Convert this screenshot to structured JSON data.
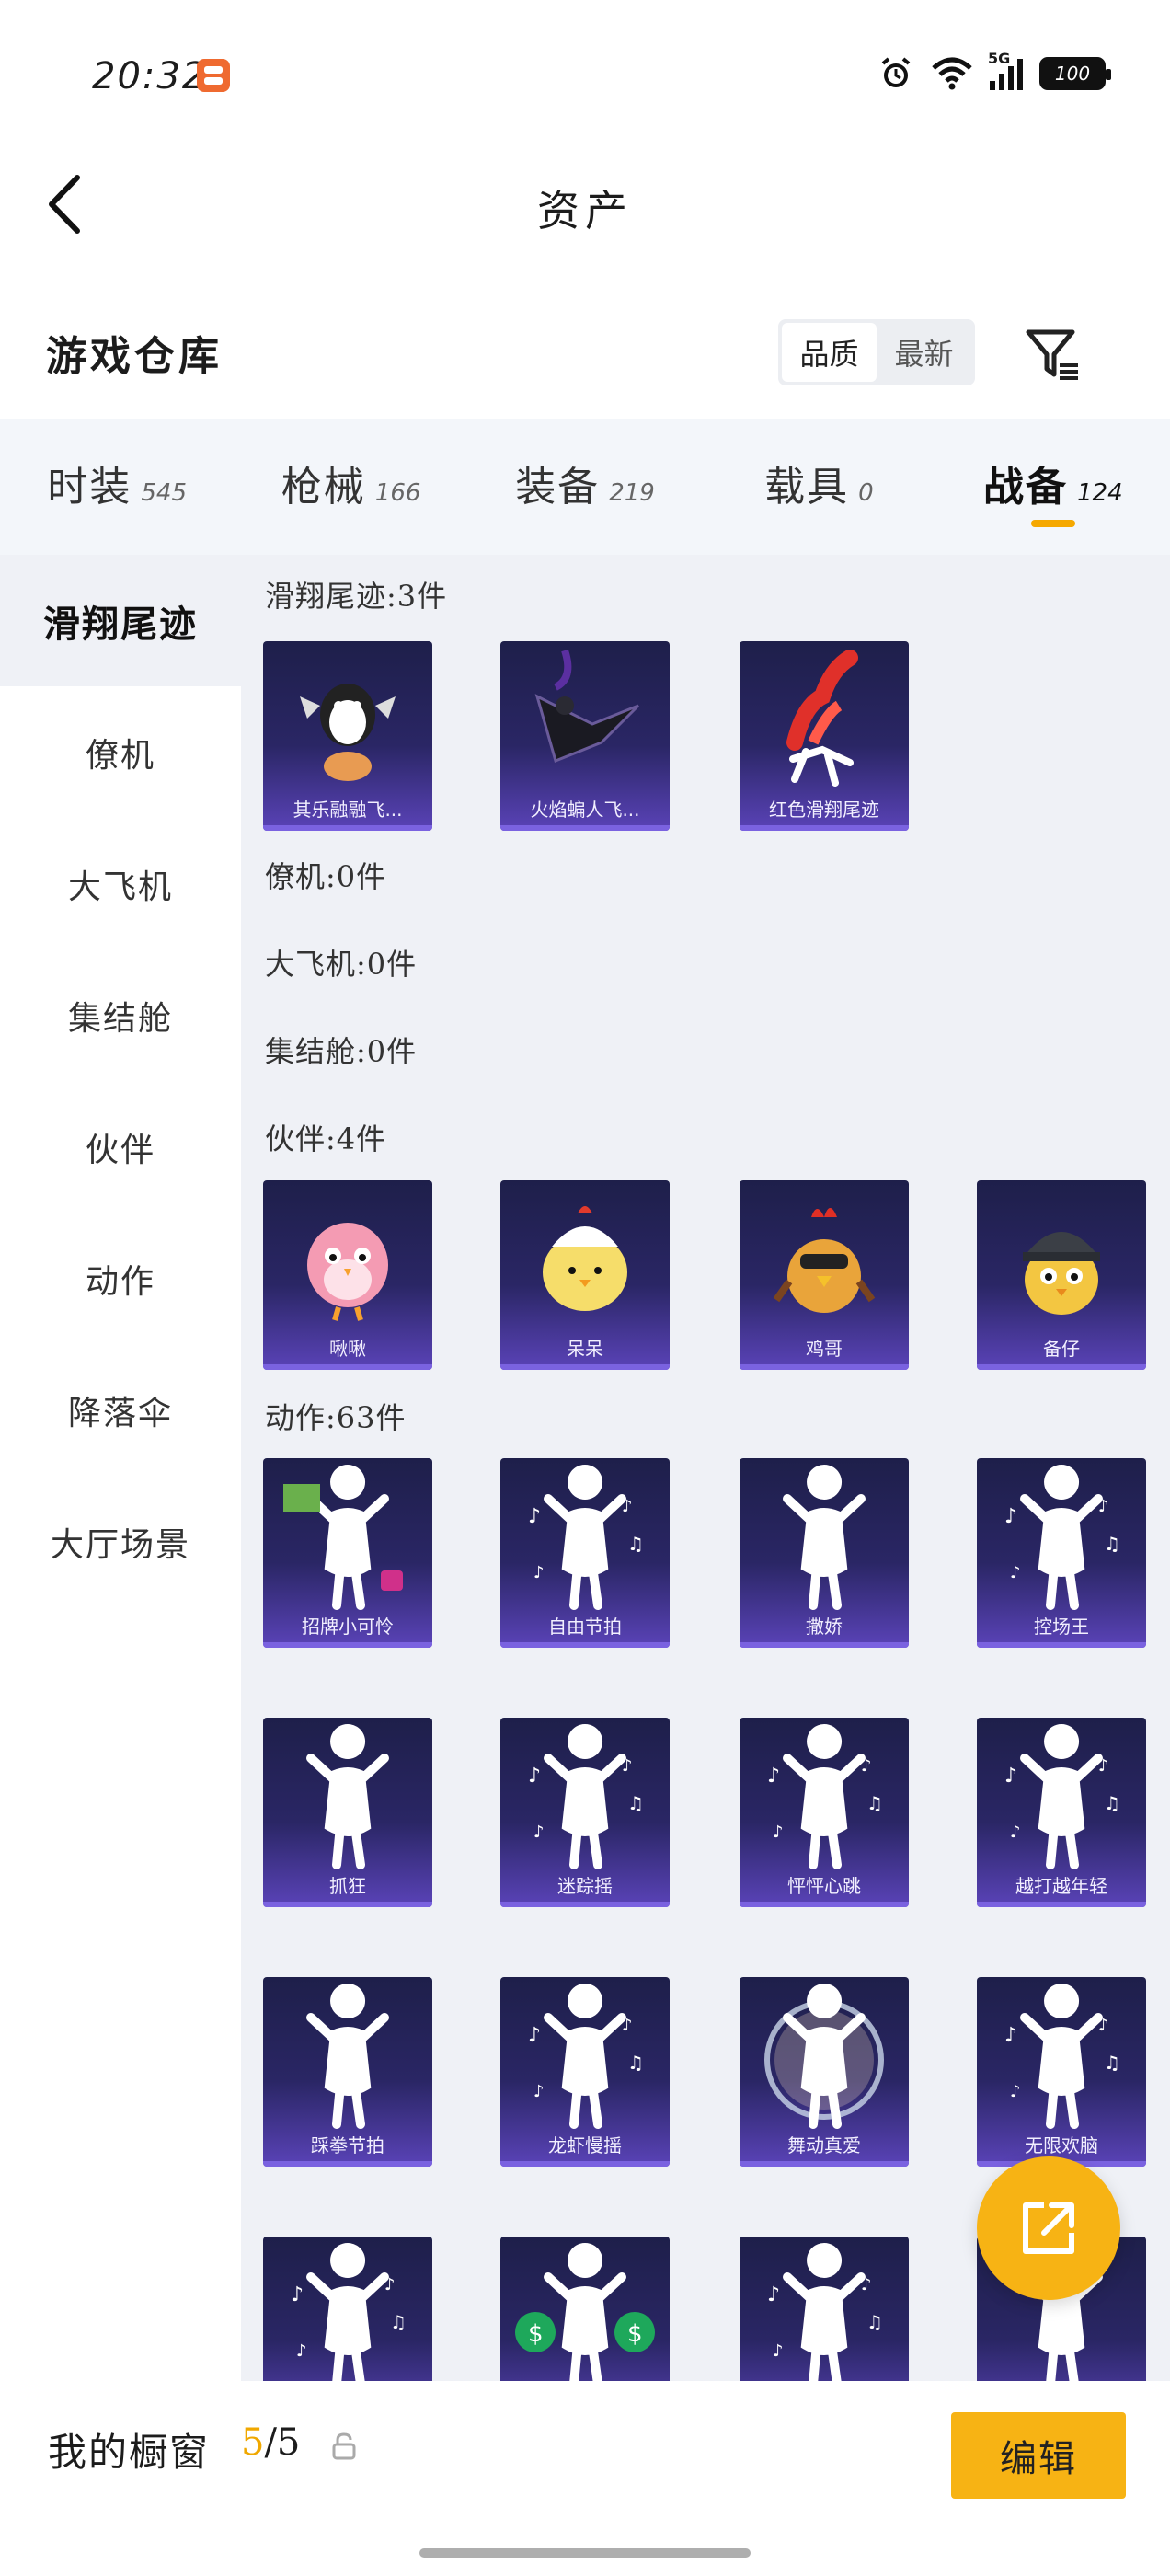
{
  "status": {
    "time": "20:32",
    "battery": "100",
    "network": "5G"
  },
  "header": {
    "title": "资产"
  },
  "warehouse": {
    "title": "游戏仓库",
    "sort_options": [
      "品质",
      "最新"
    ],
    "active_sort": "品质"
  },
  "tabs": [
    {
      "label": "时装",
      "count": "545"
    },
    {
      "label": "枪械",
      "count": "166"
    },
    {
      "label": "装备",
      "count": "219"
    },
    {
      "label": "载具",
      "count": "0"
    },
    {
      "label": "战备",
      "count": "124"
    }
  ],
  "active_tab": "战备",
  "accent_color": "#f7b314",
  "sidebar": [
    {
      "label": "滑翔尾迹"
    },
    {
      "label": "僚机"
    },
    {
      "label": "大飞机"
    },
    {
      "label": "集结舱"
    },
    {
      "label": "伙伴"
    },
    {
      "label": "动作"
    },
    {
      "label": "降落伞"
    },
    {
      "label": "大厅场景"
    }
  ],
  "sections": [
    {
      "title": "滑翔尾迹:3件",
      "items": [
        {
          "label": "其乐融融飞...",
          "icon": "penguin-glider"
        },
        {
          "label": "火焰蝙人飞...",
          "icon": "wingsuit-rider"
        },
        {
          "label": "红色滑翔尾迹",
          "icon": "red-smoke-trail"
        }
      ]
    },
    {
      "title": "僚机:0件",
      "items": []
    },
    {
      "title": "大飞机:0件",
      "items": []
    },
    {
      "title": "集结舱:0件",
      "items": []
    },
    {
      "title": "伙伴:4件",
      "items": [
        {
          "label": "啾啾",
          "icon": "pink-bird"
        },
        {
          "label": "呆呆",
          "icon": "yellow-chick"
        },
        {
          "label": "鸡哥",
          "icon": "rooster"
        },
        {
          "label": "备仔",
          "icon": "helmet-chick"
        }
      ]
    },
    {
      "title": "动作:63件",
      "items": [
        {
          "label": "招牌小可怜",
          "icon": "emote-sign"
        },
        {
          "label": "自由节拍",
          "icon": "emote-dance"
        },
        {
          "label": "撒娇",
          "icon": "emote-pose"
        },
        {
          "label": "控场王",
          "icon": "emote-dance"
        },
        {
          "label": "抓狂",
          "icon": "emote-pose"
        },
        {
          "label": "迷踪摇",
          "icon": "emote-dance"
        },
        {
          "label": "怦怦心跳",
          "icon": "emote-dance"
        },
        {
          "label": "越打越年轻",
          "icon": "emote-dance"
        },
        {
          "label": "踩拳节拍",
          "icon": "emote-pose"
        },
        {
          "label": "龙虾慢摇",
          "icon": "emote-dance"
        },
        {
          "label": "舞动真爱",
          "icon": "emote-bubble"
        },
        {
          "label": "无限欢脑",
          "icon": "emote-dance"
        },
        {
          "label": "",
          "icon": "emote-dance"
        },
        {
          "label": "",
          "icon": "emote-money"
        },
        {
          "label": "",
          "icon": "emote-dance"
        },
        {
          "label": "",
          "icon": "emote-pose"
        }
      ]
    }
  ],
  "bottom": {
    "showcase_label": "我的橱窗",
    "showcase_current": "5",
    "showcase_total": "/5",
    "edit_label": "编辑"
  }
}
